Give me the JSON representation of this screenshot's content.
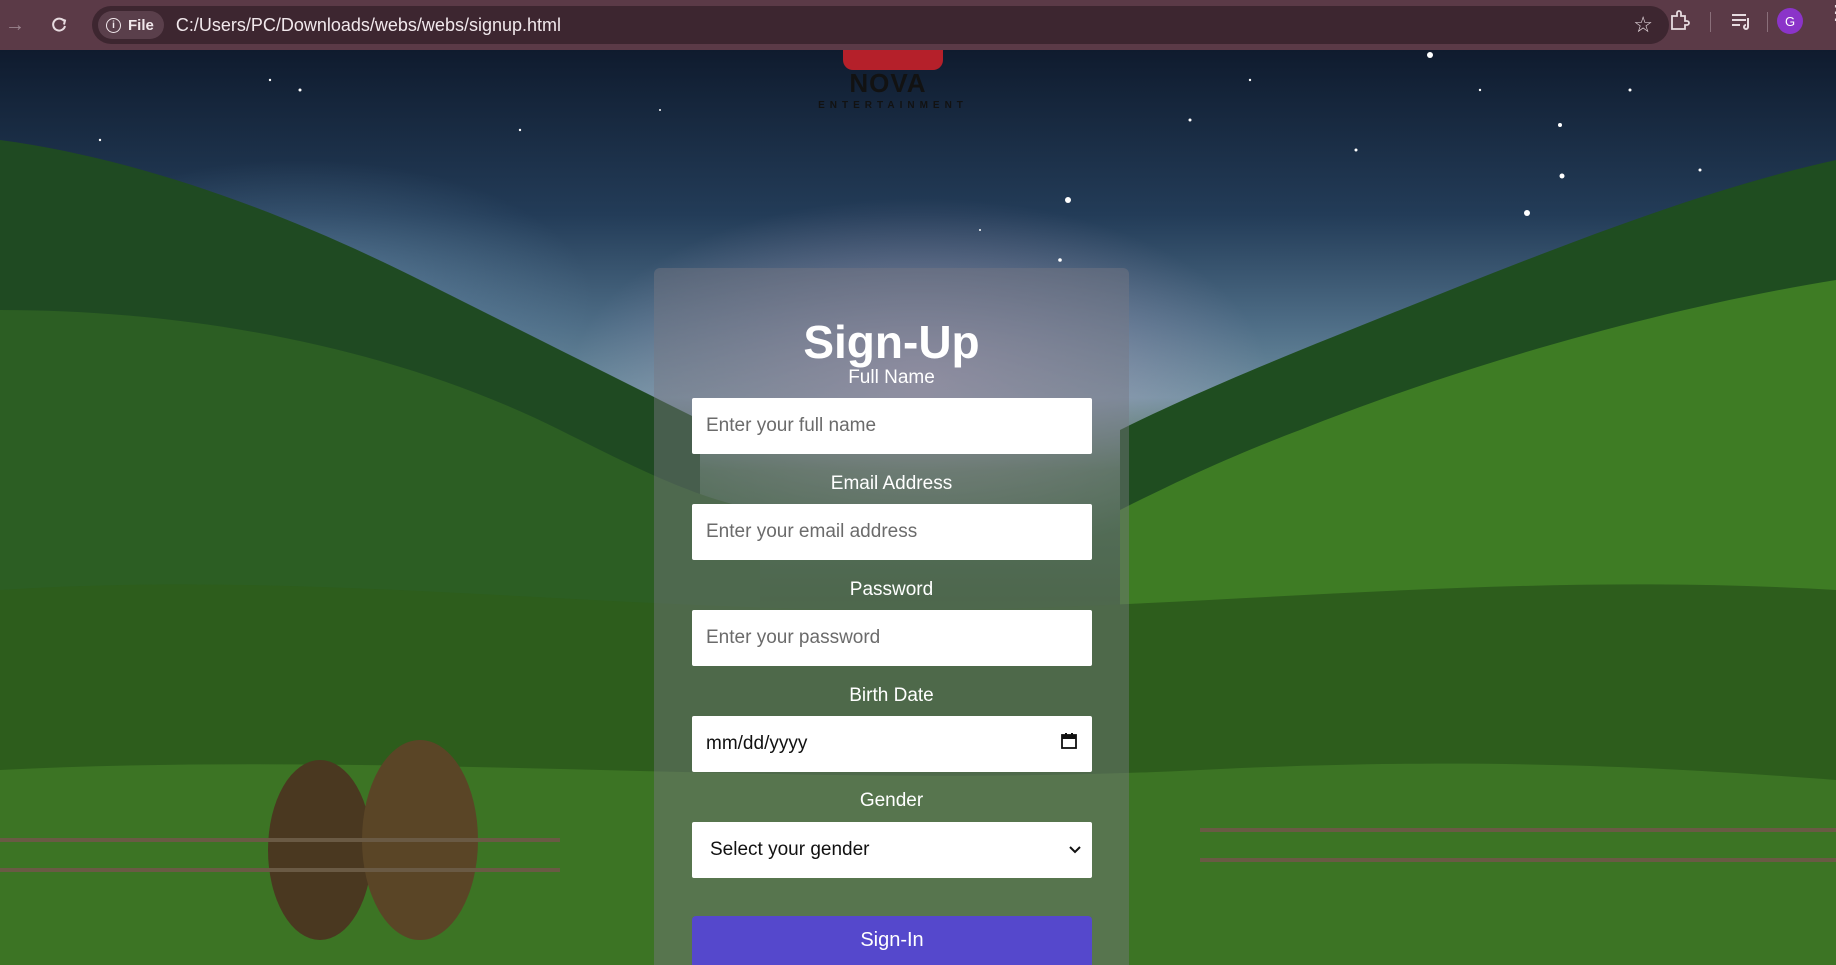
{
  "browser": {
    "file_chip": "File",
    "url": "C:/Users/PC/Downloads/webs/webs/signup.html",
    "avatar_letter": "G"
  },
  "logo": {
    "name": "NOVA",
    "tagline": "ENTERTAINMENT"
  },
  "form": {
    "title": "Sign-Up",
    "full_name": {
      "label": "Full Name",
      "placeholder": "Enter your full name"
    },
    "email": {
      "label": "Email Address",
      "placeholder": "Enter your email address"
    },
    "password": {
      "label": "Password",
      "placeholder": "Enter your password"
    },
    "birth_date": {
      "label": "Birth Date",
      "value": "mm/dd/yyyy"
    },
    "gender": {
      "label": "Gender",
      "selected": "Select your gender"
    },
    "submit_label": "Sign-In"
  },
  "colors": {
    "chrome": "#5b3a47",
    "submit": "#5548cc"
  }
}
